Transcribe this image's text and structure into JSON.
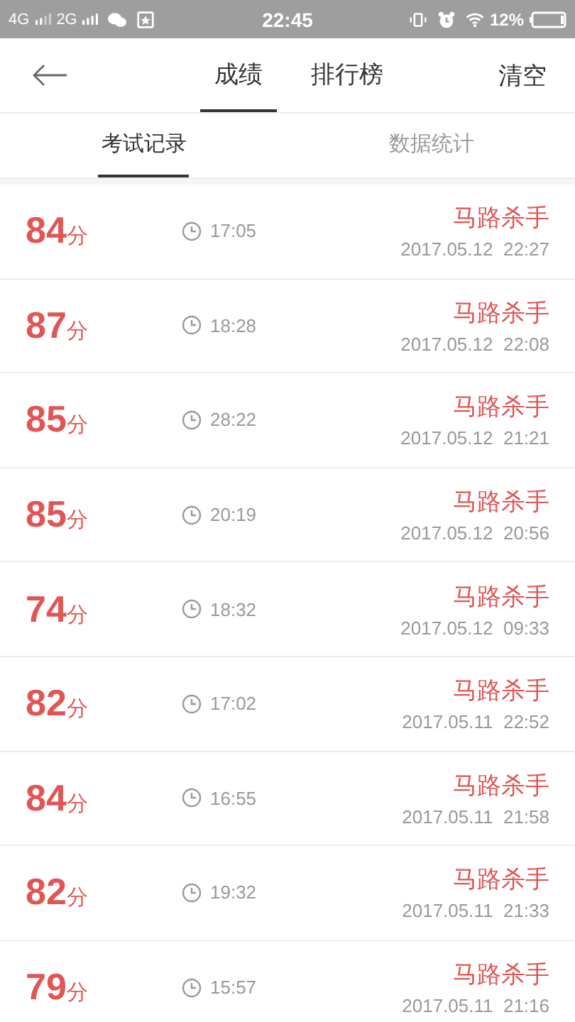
{
  "status_bar": {
    "network_1": "4G",
    "network_2": "2G",
    "time": "22:45",
    "battery": "12%"
  },
  "header": {
    "tabs": [
      {
        "label": "成绩",
        "selected": true
      },
      {
        "label": "排行榜",
        "selected": false
      }
    ],
    "action": "清空"
  },
  "sub_tabs": [
    {
      "label": "考试记录",
      "selected": true
    },
    {
      "label": "数据统计",
      "selected": false
    }
  ],
  "records": [
    {
      "score": "84",
      "unit": "分",
      "duration": "17:05",
      "name": "马路杀手",
      "datetime": "2017.05.12  22:27"
    },
    {
      "score": "87",
      "unit": "分",
      "duration": "18:28",
      "name": "马路杀手",
      "datetime": "2017.05.12  22:08"
    },
    {
      "score": "85",
      "unit": "分",
      "duration": "28:22",
      "name": "马路杀手",
      "datetime": "2017.05.12  21:21"
    },
    {
      "score": "85",
      "unit": "分",
      "duration": "20:19",
      "name": "马路杀手",
      "datetime": "2017.05.12  20:56"
    },
    {
      "score": "74",
      "unit": "分",
      "duration": "18:32",
      "name": "马路杀手",
      "datetime": "2017.05.12  09:33"
    },
    {
      "score": "82",
      "unit": "分",
      "duration": "17:02",
      "name": "马路杀手",
      "datetime": "2017.05.11  22:52"
    },
    {
      "score": "84",
      "unit": "分",
      "duration": "16:55",
      "name": "马路杀手",
      "datetime": "2017.05.11  21:58"
    },
    {
      "score": "82",
      "unit": "分",
      "duration": "19:32",
      "name": "马路杀手",
      "datetime": "2017.05.11  21:33"
    },
    {
      "score": "79",
      "unit": "分",
      "duration": "15:57",
      "name": "马路杀手",
      "datetime": "2017.05.11  21:16"
    }
  ]
}
